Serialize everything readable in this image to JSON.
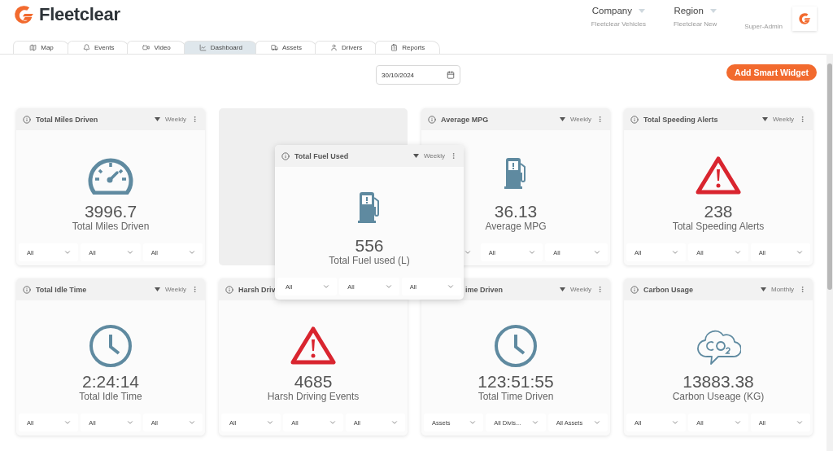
{
  "brand": {
    "name": "Fleetclear"
  },
  "selectors": [
    {
      "label": "Company",
      "value": "Fleetclear Vehicles"
    },
    {
      "label": "Region",
      "value": "Fleetclear New"
    }
  ],
  "role": "Super-Admin",
  "tabs": [
    {
      "label": "Map",
      "selected": false
    },
    {
      "label": "Events",
      "selected": false
    },
    {
      "label": "Video",
      "selected": false
    },
    {
      "label": "Dashboard",
      "selected": true
    },
    {
      "label": "Assets",
      "selected": false
    },
    {
      "label": "Drivers",
      "selected": false
    },
    {
      "label": "Reports",
      "selected": false
    }
  ],
  "date_field": {
    "value": "30/10/2024"
  },
  "add_button": "Add Smart Widget",
  "widgets": [
    {
      "kind": "gauge",
      "title": "Total Miles Driven",
      "period": "Weekly",
      "value": "3996.7",
      "label": "Total Miles Driven",
      "filters": [
        {
          "label": "All"
        },
        {
          "label": "All"
        },
        {
          "label": "All"
        }
      ]
    },
    {
      "kind": "placeholder"
    },
    {
      "kind": "fuel",
      "title": "Average MPG",
      "period": "Weekly",
      "value": "36.13",
      "label": "Average MPG",
      "filters": [
        {
          "kind": "covered"
        },
        {
          "kind": "select",
          "label": "All"
        },
        {
          "kind": "select",
          "label": "All"
        }
      ]
    },
    {
      "kind": "warning",
      "title": "Total Speeding Alerts",
      "period": "Weekly",
      "value": "238",
      "label": "Total Speeding Alerts",
      "filters": [
        {
          "label": "All"
        },
        {
          "label": "All"
        },
        {
          "label": "All"
        }
      ]
    },
    {
      "kind": "clock",
      "title": "Total Idle Time",
      "period": "Weekly",
      "value": "2:24:14",
      "label": "Total Idle Time",
      "filters": [
        {
          "label": "All"
        },
        {
          "label": "All"
        },
        {
          "label": "All"
        }
      ]
    },
    {
      "kind": "warning",
      "title": "Harsh Driv",
      "value": "4685",
      "label": "Harsh Driving Events",
      "filters": [
        {
          "label": "All"
        },
        {
          "label": "All"
        },
        {
          "label": "All"
        }
      ]
    },
    {
      "kind": "clock",
      "title": "ime Driven",
      "period": "Weekly",
      "value": "123:51:55",
      "label": "Total Time Driven",
      "filters": [
        {
          "label": "Assets"
        },
        {
          "label": "All Divis..."
        },
        {
          "label": "All Assets"
        }
      ]
    },
    {
      "kind": "co2",
      "title": "Carbon Usage",
      "period": "Monthly",
      "value": "13883.38",
      "label": "Carbon Useage (KG)",
      "filters": [
        {
          "label": "All"
        },
        {
          "label": "All"
        },
        {
          "label": "All"
        }
      ]
    }
  ],
  "dragged_widget": {
    "kind": "fuel",
    "title": "Total Fuel Used",
    "period": "Weekly",
    "value": "556",
    "label": "Total Fuel used (L)",
    "filters": [
      {
        "label": "All"
      },
      {
        "label": "All"
      },
      {
        "label": "All"
      }
    ]
  }
}
